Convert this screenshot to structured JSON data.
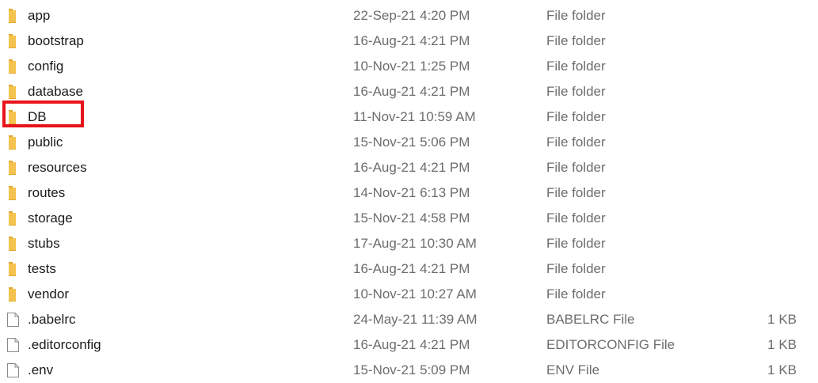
{
  "colors": {
    "folder": "#f4c24e",
    "folder_dark": "#e3a72f",
    "highlight": "#e8141b",
    "secondary_text": "#6d6d6d"
  },
  "files": [
    {
      "name": "app",
      "date": "22-Sep-21 4:20 PM",
      "type": "File folder",
      "size": "",
      "icon": "folder-icon"
    },
    {
      "name": "bootstrap",
      "date": "16-Aug-21 4:21 PM",
      "type": "File folder",
      "size": "",
      "icon": "folder-icon"
    },
    {
      "name": "config",
      "date": "10-Nov-21 1:25 PM",
      "type": "File folder",
      "size": "",
      "icon": "folder-icon"
    },
    {
      "name": "database",
      "date": "16-Aug-21 4:21 PM",
      "type": "File folder",
      "size": "",
      "icon": "folder-icon"
    },
    {
      "name": "DB",
      "date": "11-Nov-21 10:59 AM",
      "type": "File folder",
      "size": "",
      "icon": "folder-icon"
    },
    {
      "name": "public",
      "date": "15-Nov-21 5:06 PM",
      "type": "File folder",
      "size": "",
      "icon": "folder-icon"
    },
    {
      "name": "resources",
      "date": "16-Aug-21 4:21 PM",
      "type": "File folder",
      "size": "",
      "icon": "folder-icon"
    },
    {
      "name": "routes",
      "date": "14-Nov-21 6:13 PM",
      "type": "File folder",
      "size": "",
      "icon": "folder-icon"
    },
    {
      "name": "storage",
      "date": "15-Nov-21 4:58 PM",
      "type": "File folder",
      "size": "",
      "icon": "folder-icon"
    },
    {
      "name": "stubs",
      "date": "17-Aug-21 10:30 AM",
      "type": "File folder",
      "size": "",
      "icon": "folder-icon"
    },
    {
      "name": "tests",
      "date": "16-Aug-21 4:21 PM",
      "type": "File folder",
      "size": "",
      "icon": "folder-icon"
    },
    {
      "name": "vendor",
      "date": "10-Nov-21 10:27 AM",
      "type": "File folder",
      "size": "",
      "icon": "folder-icon"
    },
    {
      "name": ".babelrc",
      "date": "24-May-21 11:39 AM",
      "type": "BABELRC File",
      "size": "1 KB",
      "icon": "file-icon"
    },
    {
      "name": ".editorconfig",
      "date": "16-Aug-21 4:21 PM",
      "type": "EDITORCONFIG File",
      "size": "1 KB",
      "icon": "file-icon"
    },
    {
      "name": ".env",
      "date": "15-Nov-21 5:09 PM",
      "type": "ENV File",
      "size": "1 KB",
      "icon": "file-icon"
    }
  ]
}
